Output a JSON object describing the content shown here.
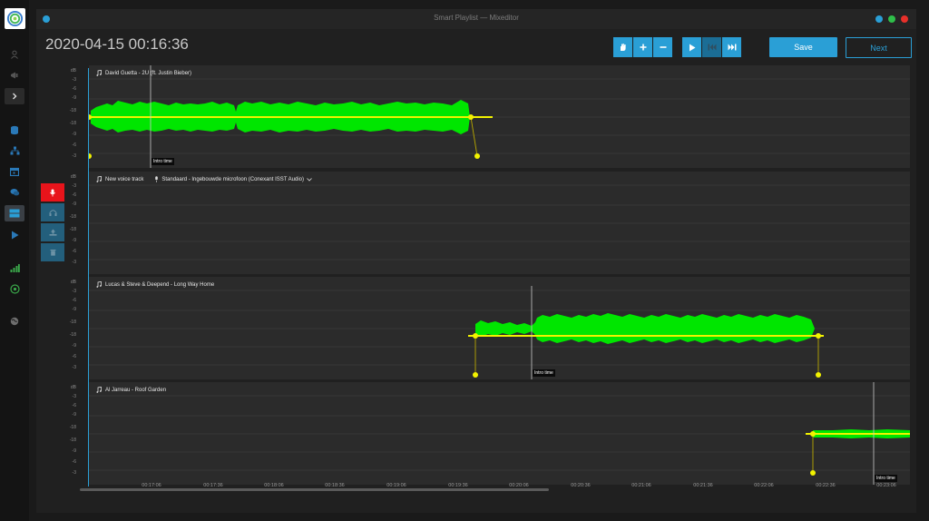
{
  "window": {
    "title": "Smart Playlist — Mixeditor",
    "controls": [
      "close",
      "minimize",
      "maximize"
    ]
  },
  "colors": {
    "accent": "#2a9fd6",
    "waveform": "#00e600",
    "envelope": "#f2f200",
    "record": "#e8141b"
  },
  "sidebar": {
    "items": [
      {
        "icon": "user-icon"
      },
      {
        "icon": "megaphone-icon"
      },
      {
        "icon": "chevron-right-icon"
      },
      {
        "icon": "database-icon"
      },
      {
        "icon": "sitemap-icon"
      },
      {
        "icon": "calendar-icon"
      },
      {
        "icon": "comments-icon"
      },
      {
        "icon": "playlist-editor-icon"
      },
      {
        "icon": "play-icon"
      },
      {
        "icon": "signal-bars-icon"
      },
      {
        "icon": "network-icon"
      },
      {
        "icon": "globe-icon"
      }
    ]
  },
  "header": {
    "datetime": "2020-04-15 00:16:36",
    "save_label": "Save",
    "next_label": "Next"
  },
  "toolbar": {
    "buttons": [
      "hand-icon",
      "zoom-in-icon",
      "zoom-out-icon",
      "play-icon",
      "skip-back-icon",
      "skip-forward-icon"
    ]
  },
  "db_scale": [
    "dB",
    "-3",
    "-6",
    "-9",
    "-18",
    "-18",
    "-9",
    "-6",
    "-3"
  ],
  "tracks": [
    {
      "name": "David Guetta - 2U (ft. Justin Bieber)",
      "intro_label": "Intro time"
    },
    {
      "name": "New voice track",
      "input_device": "Standaard - Ingebouwde microfoon (Conexant ISST Audio)"
    },
    {
      "name": "Lucas & Steve & Deepend - Long Way Home",
      "intro_label": "Intro time"
    },
    {
      "name": "Al Jarreau - Roof Garden",
      "intro_label": "Intro time"
    }
  ],
  "voice_track_buttons": [
    "microphone-icon",
    "headphones-icon",
    "upload-icon",
    "trash-icon"
  ],
  "timeline": {
    "ticks": [
      "00:17:06",
      "00:17:36",
      "00:18:06",
      "00:18:36",
      "00:19:06",
      "00:19:36",
      "00:20:06",
      "00:20:36",
      "00:21:06",
      "00:21:36",
      "00:22:06",
      "00:22:36",
      "00:23:06"
    ]
  }
}
